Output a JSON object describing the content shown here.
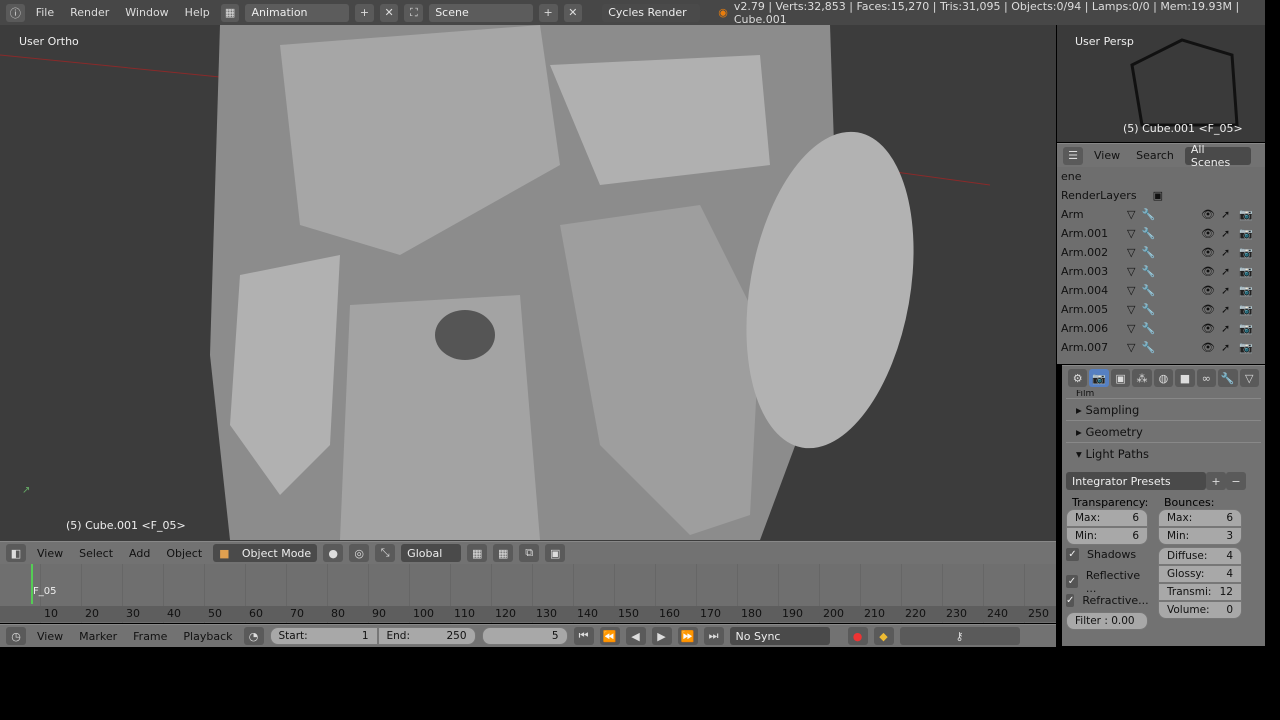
{
  "topbar": {
    "menus": [
      "File",
      "Render",
      "Window",
      "Help"
    ],
    "layout": "Animation",
    "scene": "Scene",
    "engine": "Cycles Render",
    "stats": "v2.79 | Verts:32,853 | Faces:15,270 | Tris:31,095 | Objects:0/94 | Lamps:0/0 | Mem:19.93M | Cube.001"
  },
  "viewport": {
    "view_label": "User Ortho",
    "object_label": "(5) Cube.001 <F_05>"
  },
  "view3d_header": {
    "menus": [
      "View",
      "Select",
      "Add",
      "Object"
    ],
    "mode": "Object Mode",
    "orientation": "Global"
  },
  "mini_viewport": {
    "view_label": "User Persp",
    "object_label": "(5) Cube.001 <F_05>"
  },
  "outliner": {
    "menus": [
      "View",
      "Search"
    ],
    "filter": "All Scenes",
    "scene_row": "ene",
    "renderlayers": "RenderLayers",
    "items": [
      "Arm",
      "Arm.001",
      "Arm.002",
      "Arm.003",
      "Arm.004",
      "Arm.005",
      "Arm.006",
      "Arm.007"
    ]
  },
  "properties": {
    "partial_panel": "Film",
    "panels": [
      "Sampling",
      "Geometry",
      "Light Paths"
    ],
    "integrator_presets": "Integrator Presets",
    "transparency_label": "Transparency:",
    "bounces_label": "Bounces:",
    "transparency": [
      {
        "label": "Max:",
        "value": "6"
      },
      {
        "label": "Min:",
        "value": "6"
      }
    ],
    "bounces": [
      {
        "label": "Max:",
        "value": "6"
      },
      {
        "label": "Min:",
        "value": "3"
      }
    ],
    "bounce_types": [
      {
        "label": "Diffuse:",
        "value": "4"
      },
      {
        "label": "Glossy:",
        "value": "4"
      },
      {
        "label": "Transmi:",
        "value": "12"
      },
      {
        "label": "Volume:",
        "value": "0"
      }
    ],
    "checks": [
      "Shadows",
      "Reflective ...",
      "Refractive..."
    ],
    "filter": "Filter : 0.00"
  },
  "timeline": {
    "marker": "F_05",
    "ticks": [
      "10",
      "20",
      "30",
      "40",
      "50",
      "60",
      "70",
      "80",
      "90",
      "100",
      "110",
      "120",
      "130",
      "140",
      "150",
      "160",
      "170",
      "180",
      "190",
      "200",
      "210",
      "220",
      "230",
      "240",
      "250"
    ],
    "menus": [
      "View",
      "Marker",
      "Frame",
      "Playback"
    ],
    "start_label": "Start:",
    "start": "1",
    "end_label": "End:",
    "end": "250",
    "current": "5",
    "sync": "No Sync"
  }
}
